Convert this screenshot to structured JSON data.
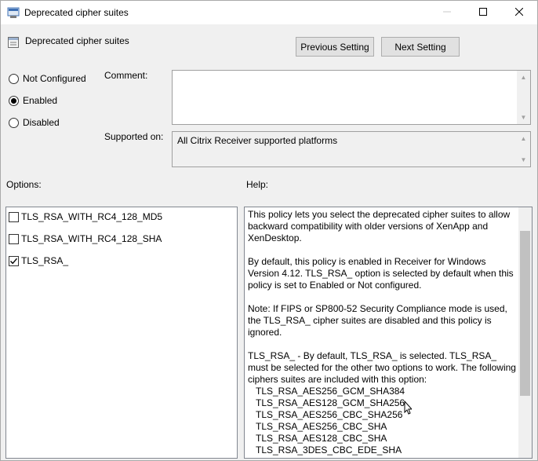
{
  "window": {
    "title": "Deprecated cipher suites",
    "controls": {
      "minimize": "minimize-icon",
      "maximize": "maximize-icon",
      "close": "close-icon"
    }
  },
  "header": {
    "policy_name": "Deprecated cipher suites",
    "prev_label": "Previous Setting",
    "next_label": "Next Setting"
  },
  "state": {
    "options": [
      {
        "label": "Not Configured",
        "checked": false
      },
      {
        "label": "Enabled",
        "checked": true
      },
      {
        "label": "Disabled",
        "checked": false
      }
    ]
  },
  "comment": {
    "label": "Comment:",
    "value": ""
  },
  "supported": {
    "label": "Supported on:",
    "value": "All Citrix Receiver supported platforms"
  },
  "options_section": {
    "label": "Options:",
    "items": [
      {
        "label": "TLS_RSA_WITH_RC4_128_MD5",
        "checked": false
      },
      {
        "label": "TLS_RSA_WITH_RC4_128_SHA",
        "checked": false
      },
      {
        "label": "TLS_RSA_",
        "checked": true
      }
    ]
  },
  "help": {
    "label": "Help:",
    "paragraphs": [
      "This policy lets you select the deprecated cipher suites to allow backward compatibility with older versions of XenApp and XenDesktop.",
      "By default, this policy is enabled in Receiver for Windows Version 4.12. TLS_RSA_ option is selected by default when this policy is set to Enabled or Not configured.",
      "Note: If FIPS or SP800-52 Security Compliance mode is used, the TLS_RSA_ cipher suites are disabled and this policy is ignored.",
      "TLS_RSA_ - By default, TLS_RSA_ is selected. TLS_RSA_ must be selected for the other two options to work. The following ciphers suites are included with this option:"
    ],
    "suites": [
      "TLS_RSA_AES256_GCM_SHA384",
      "TLS_RSA_AES128_GCM_SHA256",
      "TLS_RSA_AES256_CBC_SHA256",
      "TLS_RSA_AES256_CBC_SHA",
      "TLS_RSA_AES128_CBC_SHA",
      "TLS_RSA_3DES_CBC_EDE_SHA"
    ]
  }
}
